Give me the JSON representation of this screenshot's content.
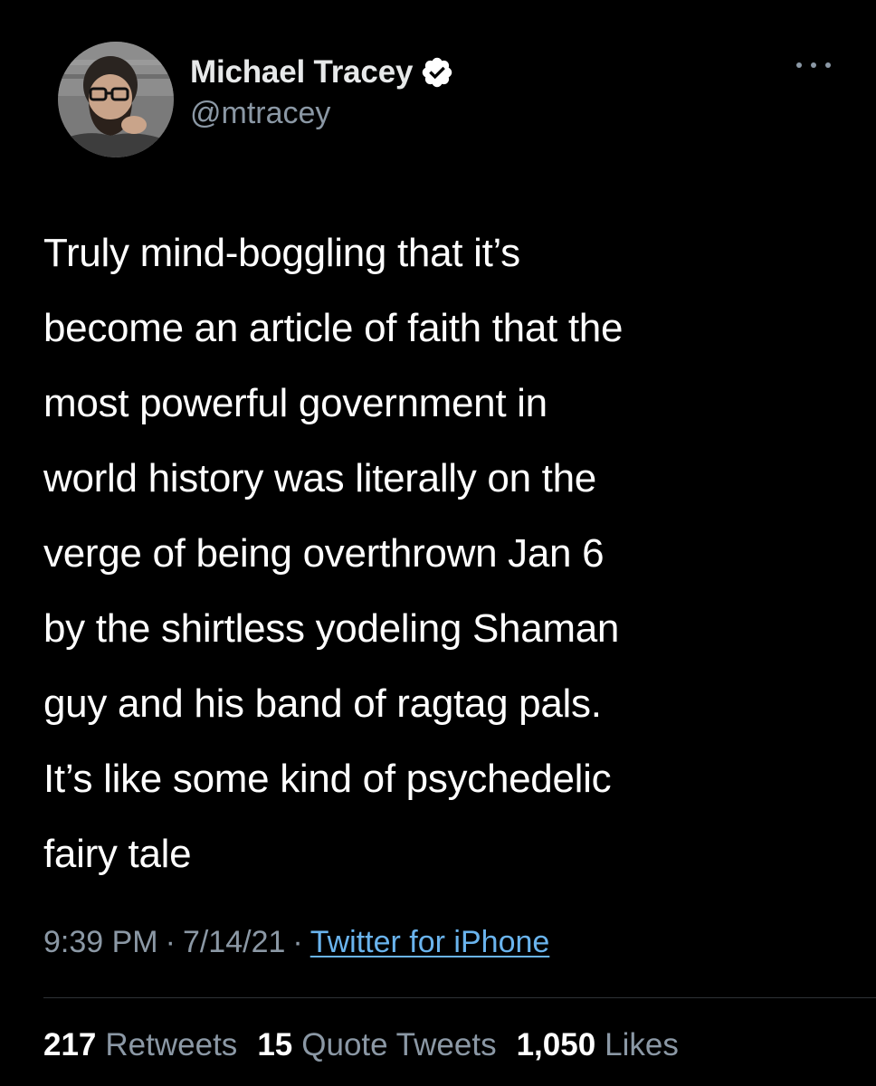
{
  "author": {
    "display_name": "Michael Tracey",
    "handle": "@mtracey",
    "verified": true,
    "avatar_icon": "profile-photo"
  },
  "tweet": {
    "text": "Truly mind-boggling that it’s\nbecome an article of faith that the\nmost powerful government in\nworld history was literally on the\nverge of being overthrown Jan 6\nby the shirtless yodeling Shaman\nguy and his band of ragtag pals.\nIt’s like some kind of psychedelic\nfairy tale"
  },
  "meta": {
    "time": "9:39 PM",
    "date": "7/14/21",
    "separator": "·",
    "source": "Twitter for iPhone"
  },
  "stats": {
    "retweets_count": "217",
    "retweets_label": "Retweets",
    "quotes_count": "15",
    "quotes_label": "Quote Tweets",
    "likes_count": "1,050",
    "likes_label": "Likes"
  },
  "colors": {
    "background": "#000000",
    "text": "#ffffff",
    "secondary": "#8b98a5",
    "link": "#6ab4ee",
    "verified_badge": "#ffffff"
  }
}
